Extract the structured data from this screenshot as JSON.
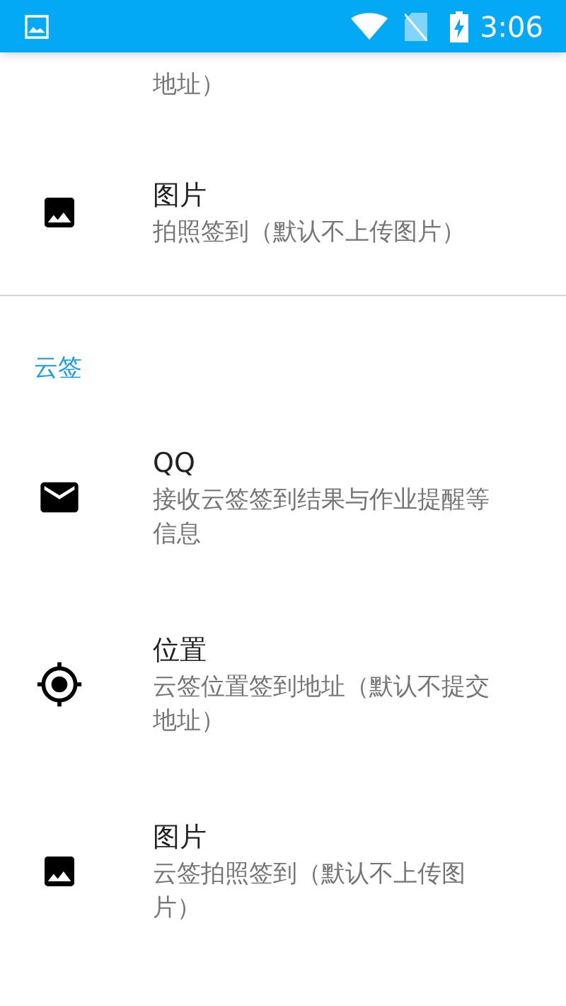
{
  "status_bar": {
    "time": "3:06"
  },
  "sections": [
    {
      "items": [
        {
          "kind": "fragment",
          "description": "地址）"
        },
        {
          "kind": "image",
          "title": "图片",
          "description": "拍照签到（默认不上传图片）"
        }
      ]
    },
    {
      "header": "云签",
      "items": [
        {
          "kind": "mail",
          "title": "QQ",
          "description": "接收云签签到结果与作业提醒等信息"
        },
        {
          "kind": "location",
          "title": "位置",
          "description": "云签位置签到地址（默认不提交地址）"
        },
        {
          "kind": "image",
          "title": "图片",
          "description": "云签拍照签到（默认不上传图片）"
        }
      ]
    }
  ]
}
